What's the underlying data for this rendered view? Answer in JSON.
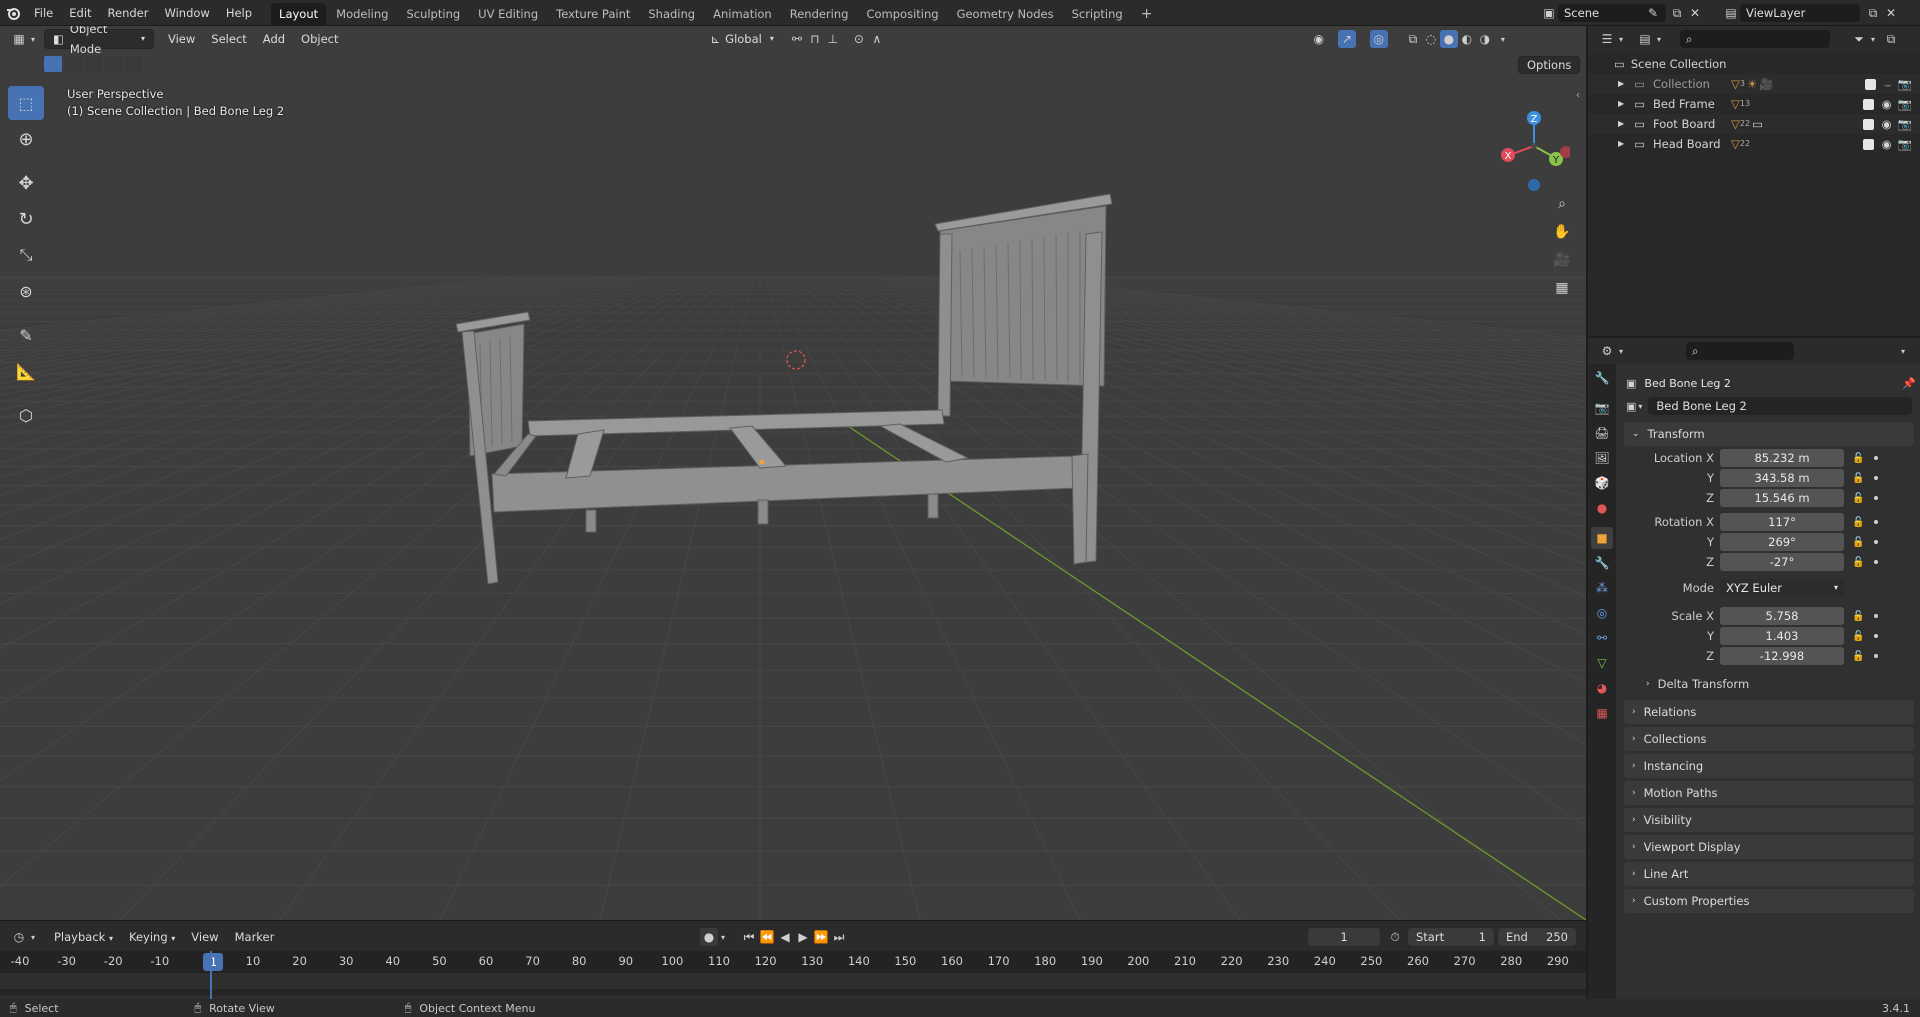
{
  "app": {
    "menu": [
      "File",
      "Edit",
      "Render",
      "Window",
      "Help"
    ],
    "workspaces": [
      "Layout",
      "Modeling",
      "Sculpting",
      "UV Editing",
      "Texture Paint",
      "Shading",
      "Animation",
      "Rendering",
      "Compositing",
      "Geometry Nodes",
      "Scripting"
    ],
    "active_workspace": "Layout",
    "add_workspace": "+",
    "scene": "Scene",
    "view_layer": "ViewLayer",
    "version": "3.4.1"
  },
  "viewport": {
    "mode": "Object Mode",
    "menus": [
      "View",
      "Select",
      "Add",
      "Object"
    ],
    "orientation": "Global",
    "options": "Options",
    "perspective_label": "User Perspective",
    "context_label": "(1) Scene Collection | Bed Bone Leg 2",
    "axes": {
      "x": "X",
      "y": "Y",
      "z": "Z"
    }
  },
  "outliner": {
    "root": "Scene Collection",
    "items": [
      {
        "name": "Collection",
        "badge": "3"
      },
      {
        "name": "Bed Frame",
        "badge": "13"
      },
      {
        "name": "Foot Board",
        "badge": "22"
      },
      {
        "name": "Head Board",
        "badge": "22"
      }
    ]
  },
  "properties": {
    "object_name": "Bed Bone Leg 2",
    "data_name": "Bed Bone Leg 2",
    "transform_title": "Transform",
    "location": {
      "label": "Location X",
      "x": "85.232 m",
      "y": "343.58 m",
      "z": "15.546 m"
    },
    "rotation": {
      "label": "Rotation X",
      "x": "117°",
      "y": "269°",
      "z": "-27°"
    },
    "mode": {
      "label": "Mode",
      "value": "XYZ Euler"
    },
    "scale": {
      "label": "Scale X",
      "x": "5.758",
      "y": "1.403",
      "z": "-12.998"
    },
    "axis_y": "Y",
    "axis_z": "Z",
    "delta_transform": "Delta Transform",
    "panels": [
      "Relations",
      "Collections",
      "Instancing",
      "Motion Paths",
      "Visibility",
      "Viewport Display",
      "Line Art",
      "Custom Properties"
    ]
  },
  "timeline": {
    "menus": [
      "Playback",
      "Keying",
      "View",
      "Marker"
    ],
    "current_frame": "1",
    "start_label": "Start",
    "start": "1",
    "end_label": "End",
    "end": "250",
    "ruler": [
      "-40",
      "-30",
      "-20",
      "-10",
      "1",
      "10",
      "20",
      "30",
      "40",
      "50",
      "60",
      "70",
      "80",
      "90",
      "100",
      "110",
      "120",
      "130",
      "140",
      "150",
      "160",
      "170",
      "180",
      "190",
      "200",
      "210",
      "220",
      "230",
      "240",
      "250",
      "260",
      "270",
      "280",
      "290"
    ]
  },
  "statusbar": {
    "select": "Select",
    "rotate": "Rotate View",
    "context_menu": "Object Context Menu"
  },
  "colors": {
    "accent": "#4772b3",
    "axis_x": "#e04a5a",
    "axis_y": "#8bc34a",
    "axis_z": "#3d8fe0",
    "active_object_tab": "#f0a23a"
  }
}
